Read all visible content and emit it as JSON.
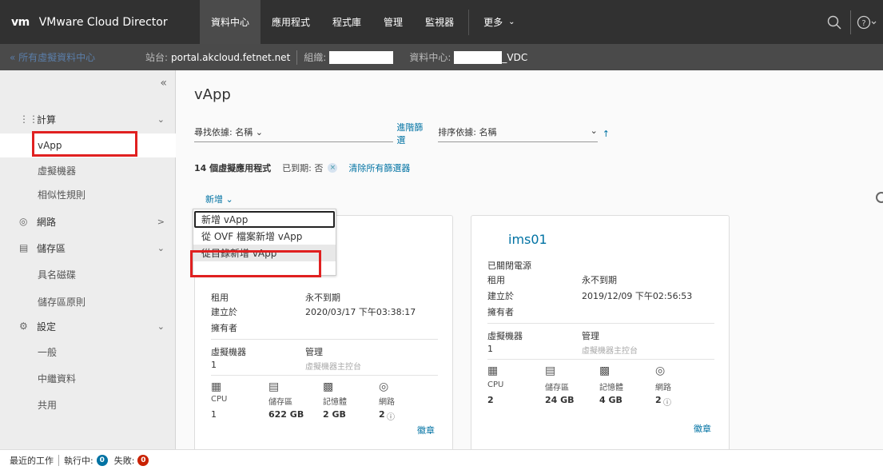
{
  "header": {
    "logo": "vm",
    "app_title": "VMware Cloud Director",
    "nav": [
      "資料中心",
      "應用程式",
      "程式庫",
      "管理",
      "監視器"
    ],
    "more": "更多"
  },
  "context": {
    "back_link": "« 所有虛擬資料中心",
    "site_label": "站台:",
    "site_value": "portal.akcloud.fetnet.net",
    "org_label": "組織:",
    "dc_label": "資料中心:",
    "dc_suffix": "_VDC"
  },
  "sidebar": {
    "collapse": "«",
    "compute": "計算",
    "vapp": "vApp",
    "vms": "虛擬機器",
    "affinity": "相似性規則",
    "network": "網路",
    "storage": "儲存區",
    "named_disks": "具名磁碟",
    "storage_policy": "儲存區原則",
    "settings": "設定",
    "general": "一般",
    "metadata": "中繼資料",
    "sharing": "共用"
  },
  "main": {
    "title": "vApp",
    "search_by": "尋找依據: 名稱",
    "advanced_filter": "進階篩選",
    "sort_by": "排序依據: 名稱",
    "count_text": "14 個虛擬應用程式",
    "expired_chip": "已到期: 否",
    "clear_filters": "清除所有篩選器",
    "new_button": "新增"
  },
  "dropdown": {
    "items": [
      "新增 vApp",
      "從 OVF 檔案新增 vApp",
      "從目錄新增 vApp"
    ]
  },
  "cards": [
    {
      "title": "",
      "status": "",
      "lease_label": "租用",
      "lease_value": "永不到期",
      "created_label": "建立於",
      "created_value": "2020/03/17 下午03:38:17",
      "owner_label": "擁有者",
      "vm_label": "虛擬機器",
      "vm_count": "1",
      "manage": "管理",
      "console": "虛擬機器主控台",
      "cpu_label": "CPU",
      "cpu": "1",
      "storage_label": "儲存區",
      "storage": "622 GB",
      "memory_label": "記憶體",
      "memory": "2 GB",
      "network_label": "網路",
      "network": "2",
      "badge": "徽章"
    },
    {
      "title": "ims01",
      "status": "已關閉電源",
      "lease_label": "租用",
      "lease_value": "永不到期",
      "created_label": "建立於",
      "created_value": "2019/12/09 下午02:56:53",
      "owner_label": "擁有者",
      "vm_label": "虛擬機器",
      "vm_count": "1",
      "manage": "管理",
      "console": "虛擬機器主控台",
      "cpu_label": "CPU",
      "cpu": "2",
      "storage_label": "儲存區",
      "storage": "24 GB",
      "memory_label": "記憶體",
      "memory": "4 GB",
      "network_label": "網路",
      "network": "2",
      "badge": "徽章"
    }
  ],
  "status": {
    "recent_tasks": "最近的工作",
    "running_label": "執行中:",
    "running_count": "0",
    "failed_label": "失敗:",
    "failed_count": "0"
  }
}
